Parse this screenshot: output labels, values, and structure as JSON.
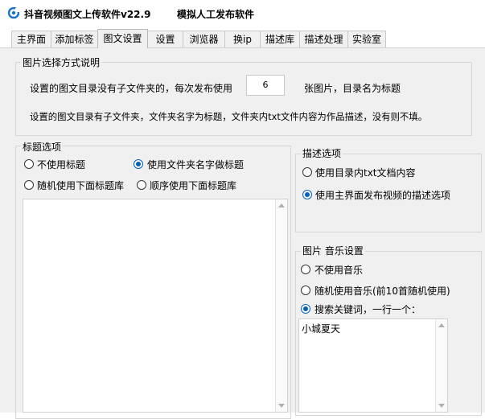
{
  "window": {
    "title": "抖音视频图文上传软件v22.9",
    "subtitle": "模拟人工发布软件",
    "icon": "app-logo-icon"
  },
  "tabs": [
    {
      "label": "主界面",
      "active": false
    },
    {
      "label": "添加标签",
      "active": false
    },
    {
      "label": "图文设置",
      "active": true
    },
    {
      "label": "设置",
      "active": false
    },
    {
      "label": "浏览器",
      "active": false
    },
    {
      "label": "换ip",
      "active": false
    },
    {
      "label": "描述库",
      "active": false
    },
    {
      "label": "描述处理",
      "active": false
    },
    {
      "label": "实验室",
      "active": false
    }
  ],
  "image_mode": {
    "legend": "图片选择方式说明",
    "line1_prefix": "设置的图文目录没有子文件夹的，每次发布使用",
    "count_value": "6",
    "line1_suffix": "张图片，目录名为标题",
    "line2": "设置的图文目录有子文件夹，文件夹名字为标题，文件夹内txt文件内容为作品描述，没有则不填。"
  },
  "title_options": {
    "legend": "标题选项",
    "options": [
      {
        "label": "不使用标题",
        "checked": false
      },
      {
        "label": "使用文件夹名字做标题",
        "checked": true
      },
      {
        "label": "随机使用下面标题库",
        "checked": false
      },
      {
        "label": "顺序使用下面标题库",
        "checked": false
      }
    ],
    "textarea_value": ""
  },
  "desc_options": {
    "legend": "描述选项",
    "options": [
      {
        "label": "使用目录内txt文档内容",
        "checked": false
      },
      {
        "label": "使用主界面发布视频的描述选项",
        "checked": true
      }
    ]
  },
  "music_settings": {
    "legend": "图片 音乐设置",
    "options": [
      {
        "label": "不使用音乐",
        "checked": false
      },
      {
        "label": "随机使用音乐(前10首随机使用)",
        "checked": false
      },
      {
        "label": "搜索关键词，一行一个：",
        "checked": true
      }
    ],
    "keywords_value": "小城夏天"
  },
  "colors": {
    "accent": "#0060c0",
    "panel_bg": "#f0f0f0",
    "border": "#d6d6d6"
  }
}
